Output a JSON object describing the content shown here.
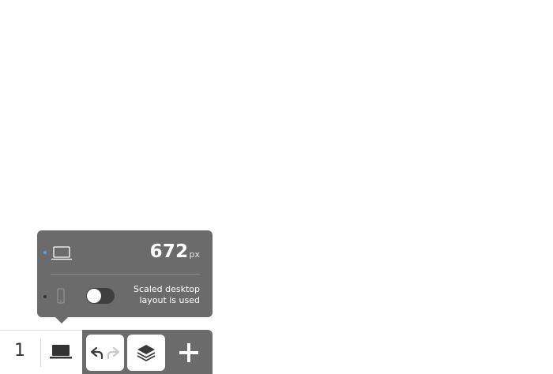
{
  "breakpoint": {
    "width_value": "672",
    "width_unit": "px",
    "desktop_icon": "laptop-icon",
    "mobile_icon": "phone-icon",
    "scaled_note_line1": "Scaled desktop",
    "scaled_note_line2": "layout is used",
    "scaled_toggle_on": false,
    "active_dot_color": "#5aa0e6"
  },
  "toolbar": {
    "page_number": "1",
    "device_icon": "laptop-icon",
    "undo_icon": "undo-icon",
    "redo_icon": "redo-icon",
    "layers_icon": "layers-icon",
    "add_icon": "plus-icon"
  },
  "colors": {
    "panel": "#6b6b6b",
    "toggle_track": "#3f3f3f"
  }
}
